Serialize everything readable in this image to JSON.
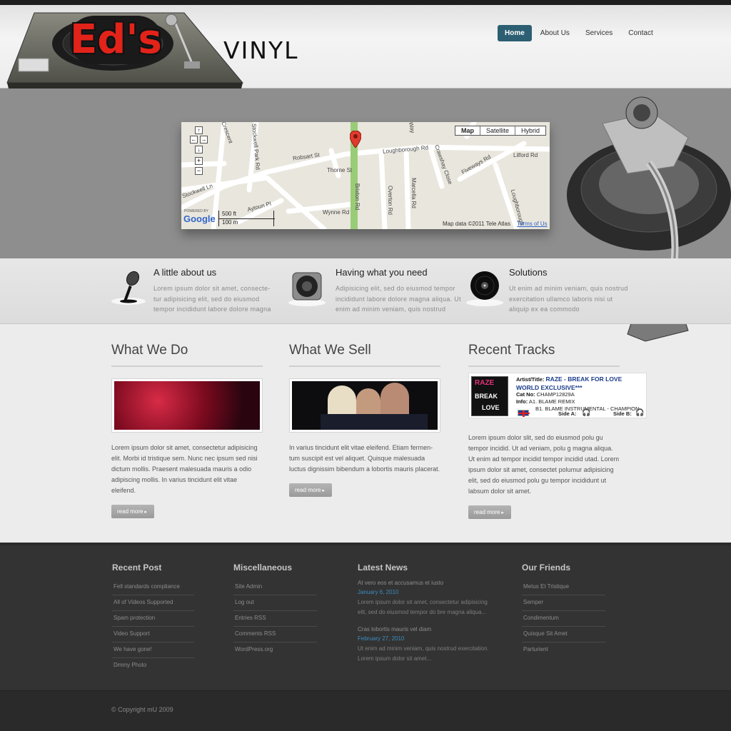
{
  "brand": {
    "logo_text": "Ed's",
    "name": "VINYL"
  },
  "nav": {
    "items": [
      {
        "label": "Home",
        "active": true
      },
      {
        "label": "About Us"
      },
      {
        "label": "Services"
      },
      {
        "label": "Contact"
      }
    ]
  },
  "map": {
    "types": [
      "Map",
      "Satellite",
      "Hybrid"
    ],
    "streets": [
      "Crescent",
      "Stockwell Park Rd",
      "Robsart St",
      "Thorne St",
      "Loughborough Rd",
      "Way",
      "Crawshay Close",
      "Fiveways Rd",
      "Lilford Rd",
      "Brixton Rd",
      "Overton Rd",
      "Marcella Rd",
      "Stockwell Ln",
      "Aytoun Pl",
      "Wynne Rd",
      "Loughborough"
    ],
    "scale_ft": "500 ft",
    "scale_m": "100 m",
    "attribution": "Map data ©2011 Tele Atlas",
    "terms": "Terms of Us",
    "powered": "POWERED BY",
    "google": "Google"
  },
  "features": [
    {
      "title": "A little about us",
      "text": "Lorem ipsum dolor sit amet, consecte-tur adipisicing elit, sed do eiusmod tempor incididunt labore dolore magna",
      "icon": "microphone-icon"
    },
    {
      "title": "Having what you need",
      "text": "Adipisicing elit, sed do eiusmod tempor incididunt labore dolore magna aliqua. Ut enim ad minim veniam, quis nostrud",
      "icon": "speaker-icon"
    },
    {
      "title": "Solutions",
      "text": "Ut enim ad minim veniam, quis nostrud exercitation ullamco laboris nisi ut aliquip ex ea commodo",
      "icon": "vinyl-record-icon"
    }
  ],
  "columns": [
    {
      "title": "What We Do",
      "text": "Lorem ipsum dolor sit amet, consectetur adipisicing elit. Morbi id tristique sem. Nunc nec ipsum sed nisi dictum mollis. Praesent malesuada mauris a odio adipiscing mollis. In varius tincidunt elit vitae eleifend.",
      "button": "read more"
    },
    {
      "title": "What We Sell",
      "text": "In varius tincidunt elit vitae eleifend. Etiam fermen-tum suscipit est vel aliquet. Quisque malesuada luctus dignissim bibendum a lobortis mauris placerat.",
      "button": "read more"
    },
    {
      "title": "Recent Tracks",
      "text": "Lorem ipsum dolor slit, sed do eiusmod polu gu tempor incidid. Ut ad veniam, polu g magna aliqua. Ut enim ad tempor incidid tempor incidid utad. Lorem ipsum dolor sit amet, consectet polumur adipisicing elit, sed do eiusmod polu gu tempor incididunt ut labsum dolor sit amet.",
      "button": "read more"
    }
  ],
  "track": {
    "artist_label": "Artist/Title:",
    "artist": "RAZE - BREAK FOR LOVE",
    "subtitle": "WORLD EXCLUSIVE***",
    "cat_label": "Cat No:",
    "cat": "CHAMP12829A",
    "info_label": "Info:",
    "a1": "A1. BLAME REMIX",
    "b1": "B1. BLAME INSTRUMENTAL - CHAMPION",
    "side_a": "Side A:",
    "side_b": "Side B:",
    "cover_top": "RAZE",
    "cover_mid": "BREAK",
    "cover_bot": "LOVE"
  },
  "footer": {
    "recent_post": {
      "title": "Recent Post",
      "items": [
        "Fell standards compliance",
        "All of Videos Supported",
        "Spam protection",
        "Video Support",
        "We have gone!",
        "Dmmy Photo"
      ]
    },
    "misc": {
      "title": "Miscellaneous",
      "items": [
        "Site Admin",
        "Log out",
        "Entries RSS",
        "Comments RSS",
        "WordPress.org"
      ]
    },
    "news": {
      "title": "Latest News",
      "items": [
        {
          "title": "At vero eos et accusamus et iusto",
          "date": "January 6, 2010",
          "text": "Lorem ipsum dolor sit amet, consectetur adipisicing elit, sed do eiusmod tempor do bre magna aliqua..."
        },
        {
          "title": "Cras lobortis mauris vel diam",
          "date": "February 27, 2010",
          "text": "Ut enim ad minim veniam, quis nostrud exercitation. Lorem ipsum dolor sit amet..."
        }
      ]
    },
    "friends": {
      "title": "Our Friends",
      "items": [
        "Metus Et Tristique",
        "Semper",
        "Condimentum",
        "Quisque Sit Amet",
        "Parturient"
      ]
    }
  },
  "copyright": "© Copyright mU 2009"
}
